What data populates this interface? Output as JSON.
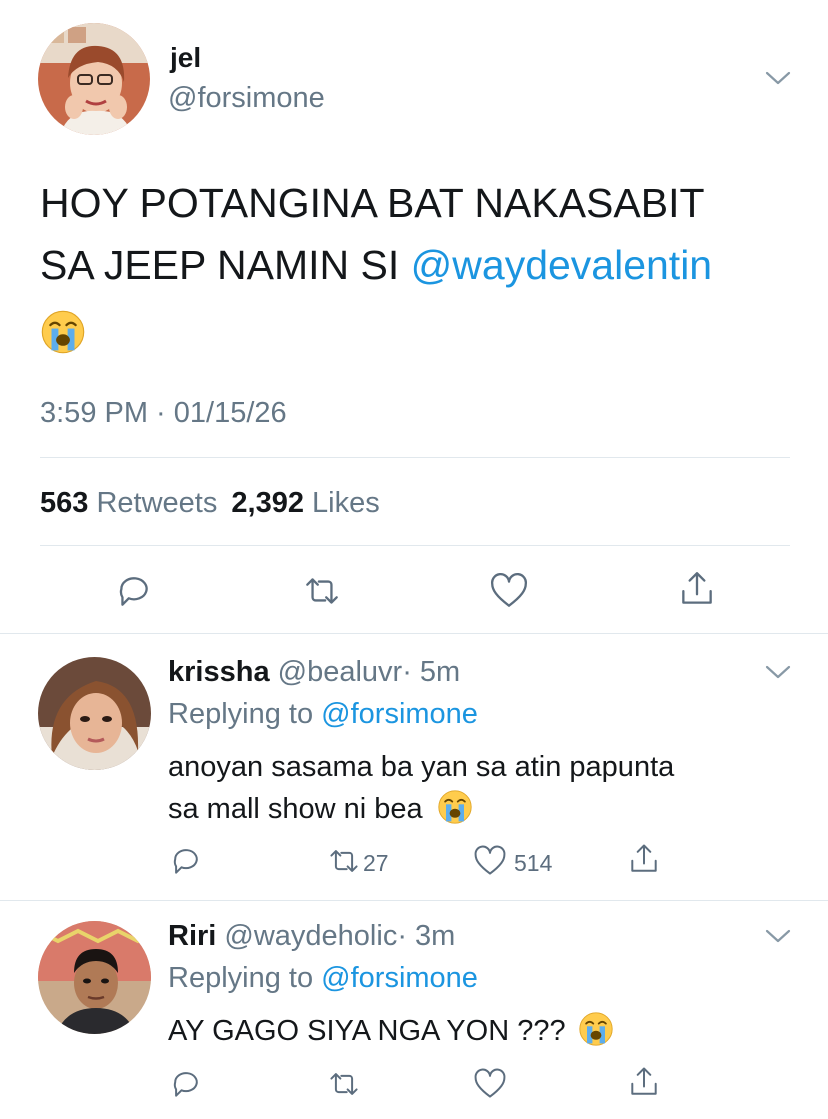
{
  "main_tweet": {
    "display_name": "jel",
    "handle": "@forsimone",
    "text_line1": "HOY POTANGINA BAT NAKASABIT",
    "text_line2_prefix": "SA JEEP NAMIN SI ",
    "mention": "@waydevalentin",
    "emoji_icon": "loudly-crying-face-icon",
    "timestamp": "3:59 PM · 01/15/26",
    "retweet_count": "563",
    "retweet_label": "Retweets",
    "like_count": "2,392",
    "like_label": "Likes"
  },
  "replies": [
    {
      "display_name": "krissha",
      "handle": "@bealuvr",
      "time": "· 5m",
      "replying_label": "Replying to ",
      "replying_to": "@forsimone",
      "text_line1": "anoyan sasama ba yan sa atin papunta",
      "text_line2": "sa mall show ni bea",
      "emoji_icon": "loudly-crying-face-icon",
      "retweets": "27",
      "likes": "514"
    },
    {
      "display_name": "Riri",
      "handle": "@waydeholic",
      "time": "· 3m",
      "replying_label": "Replying to ",
      "replying_to": "@forsimone",
      "text_line1": "AY GAGO SIYA NGA YON ???",
      "emoji_icon": "loudly-crying-face-icon"
    }
  ],
  "colors": {
    "link": "#1b95e0",
    "secondary_text": "#657786",
    "divider": "#e1e8ed",
    "icon": "#5c6d7e"
  }
}
